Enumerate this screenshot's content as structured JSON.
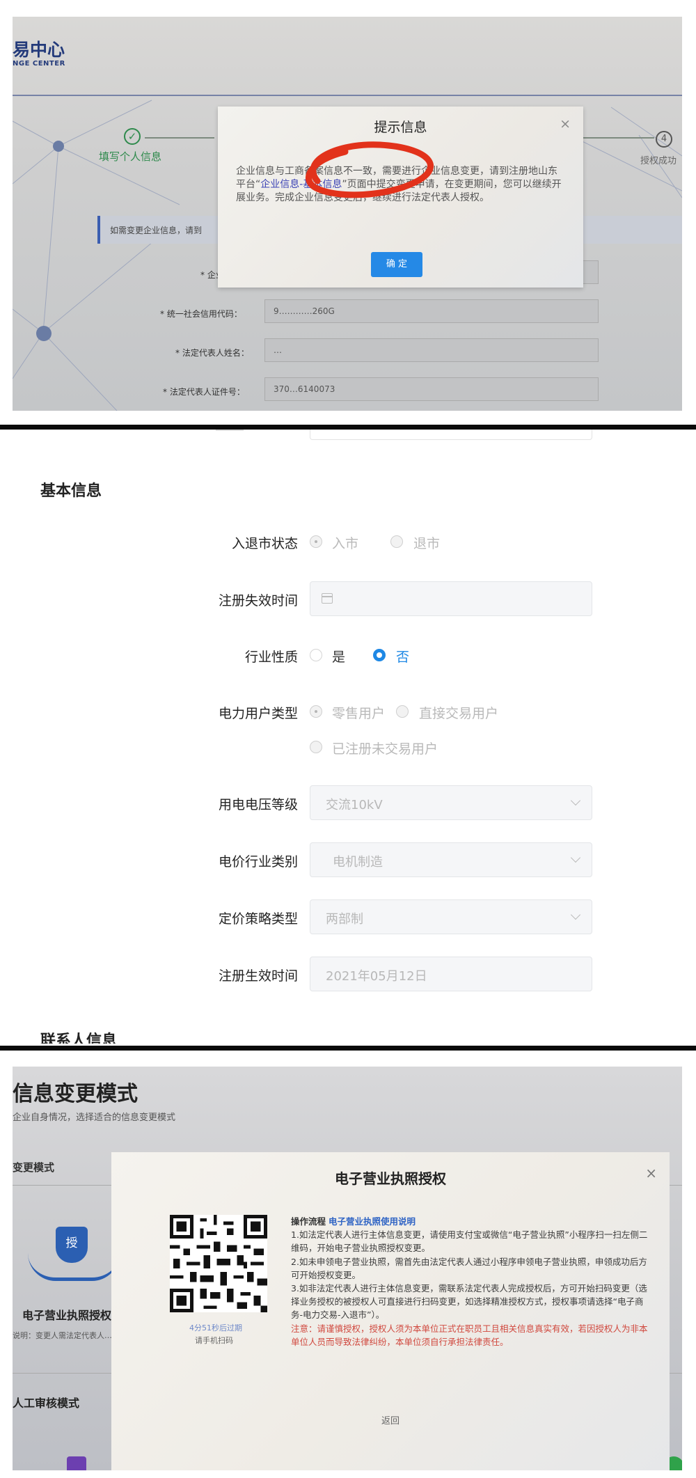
{
  "panel1": {
    "logo": "易中心",
    "logo_sub": "NGE CENTER",
    "step1_label": "填写个人信息",
    "step4_number": "4",
    "step4_label": "授权成功",
    "notice": "如需变更企业信息，请到",
    "fields": [
      {
        "label": "* 企业",
        "value": ""
      },
      {
        "label": "* 统一社会信用代码：",
        "value": "9…………260G"
      },
      {
        "label": "* 法定代表人姓名：",
        "value": "…"
      },
      {
        "label": "* 法定代表人证件号：",
        "value": "370…6140073"
      }
    ],
    "modal": {
      "title": "提示信息",
      "close": "×",
      "body_pre": "企业信息与工商备案信息不一致，需要进行企业信息变更，请到注册地山东平台“",
      "body_link": "企业信息-基本信息",
      "body_post": "”页面中提交变更申请，在变更期间，您可以继续开展业务。完成企业信息变更后，继续进行法定代表人授权。",
      "ok": "确 定"
    }
  },
  "panel2": {
    "section_title": "基本信息",
    "market_status": {
      "label": "入退市状态",
      "options": [
        "入市",
        "退市"
      ]
    },
    "reg_expire": {
      "label": "注册失效时间",
      "value": ""
    },
    "industry": {
      "label": "行业性质",
      "options": [
        "是",
        "否"
      ],
      "selected": "否"
    },
    "user_type": {
      "label": "电力用户类型",
      "options": [
        "零售用户",
        "直接交易用户",
        "已注册未交易用户"
      ]
    },
    "voltage": {
      "label": "用电电压等级",
      "value": "交流10kV"
    },
    "price_category": {
      "label": "电价行业类别",
      "value": "电机制造"
    },
    "pricing_strategy": {
      "label": "定价策略类型",
      "value": "两部制"
    },
    "reg_effective": {
      "label": "注册生效时间",
      "value": "2021年05月12日"
    },
    "next_section": "联系人信息"
  },
  "panel3": {
    "title": "信息变更模式",
    "subtitle": "企业自身情况，选择适合的信息变更模式",
    "side_label": "变更模式",
    "shield_char": "授",
    "card_label": "电子营业执照授权",
    "card_sub": "说明：变更人需法定代表人…",
    "side_label2": "人工审核模式",
    "modal": {
      "title": "电子营业执照授权",
      "close": "×",
      "timer": "4分51秒后过期",
      "scan_tip": "请手机扫码",
      "flow_title": "操作流程",
      "flow_link": "电子营业执照使用说明",
      "step1": "1.如法定代表人进行主体信息变更，请使用支付宝或微信“电子营业执照”小程序扫一扫左侧二维码，开始电子营业执照授权变更。",
      "step2": "2.如未申领电子营业执照，需首先由法定代表人通过小程序申领电子营业执照，申领成功后方可开始授权变更。",
      "step3": "3.如非法定代表人进行主体信息变更，需联系法定代表人完成授权后，方可开始扫码变更（选择业务授权的被授权人可直接进行扫码变更，如选择精准授权方式，授权事项请选择“电子商务-电力交易-入退市”）。",
      "note": "注意：请谨慎授权，授权人须为本单位正式在职员工且相关信息真实有效，若因授权人为非本单位人员而导致法律纠纷，本单位须自行承担法律责任。",
      "return": "返回"
    }
  }
}
